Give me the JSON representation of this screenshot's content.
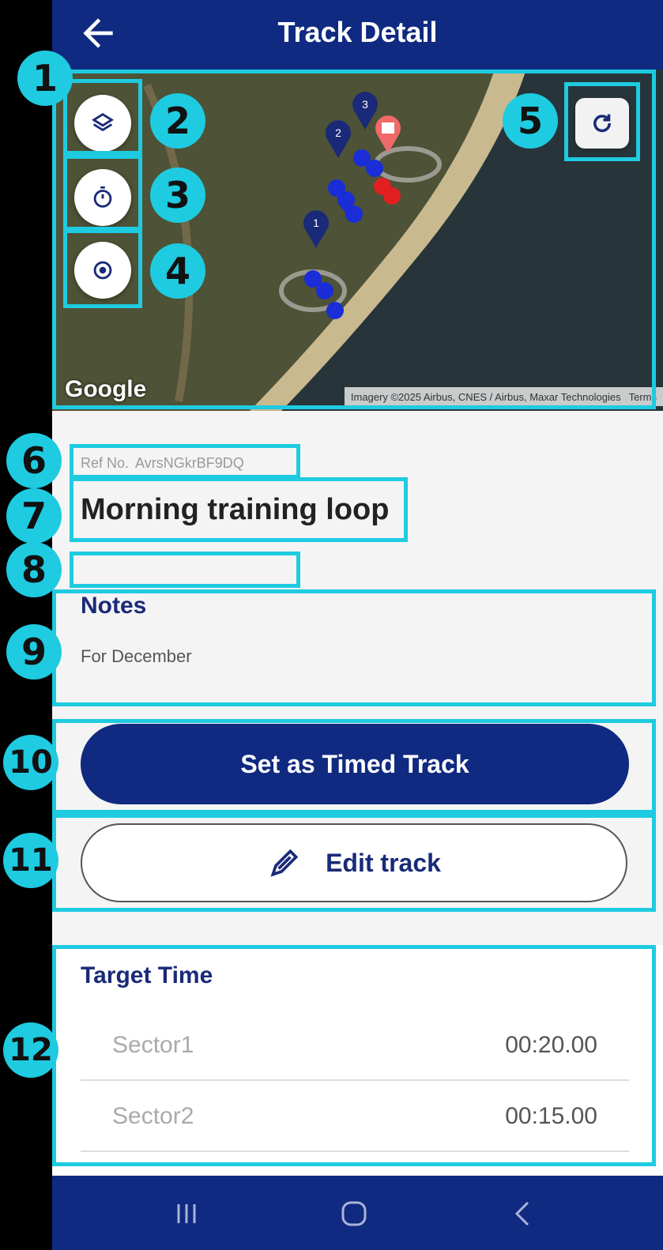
{
  "appbar": {
    "title": "Track Detail",
    "back_icon": "back-arrow-icon"
  },
  "map": {
    "google_label": "Google",
    "attribution": "Imagery ©2025 Airbus, CNES / Airbus, Maxar Technologies",
    "terms_label": "Terms",
    "controls": [
      {
        "name": "layers-icon"
      },
      {
        "name": "timer-icon"
      },
      {
        "name": "my-location-icon"
      }
    ],
    "refresh_icon": "refresh-icon",
    "markers": [
      {
        "label": "1"
      },
      {
        "label": "2"
      },
      {
        "label": "3"
      }
    ]
  },
  "track": {
    "ref_label": "Ref No.",
    "ref_value": "AvrsNGkrBF9DQ",
    "name": "Morning training loop",
    "notes_title": "Notes",
    "notes_text": "For December"
  },
  "actions": {
    "set_timed": "Set as Timed Track",
    "edit_track": "Edit track"
  },
  "target_time": {
    "title": "Target Time",
    "rows": [
      {
        "label": "Sector1",
        "value": "00:20.00"
      },
      {
        "label": "Sector2",
        "value": "00:15.00"
      }
    ]
  },
  "annotations": [
    "1",
    "2",
    "3",
    "4",
    "5",
    "6",
    "7",
    "8",
    "9",
    "10",
    "11",
    "12"
  ],
  "colors": {
    "primary": "#0f2a80",
    "annotation": "#1ecbe1"
  }
}
